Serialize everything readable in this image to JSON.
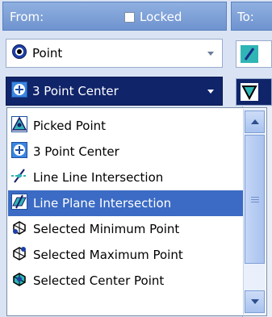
{
  "header": {
    "from_label": "From:",
    "locked_label": "Locked",
    "to_label": "To:"
  },
  "from_combos": [
    {
      "icon": "target-point-icon",
      "label": "Point"
    },
    {
      "icon": "three-point-center-icon",
      "label": "3 Point Center"
    }
  ],
  "dropdown": {
    "items": [
      {
        "icon": "picked-point-icon",
        "label": "Picked Point"
      },
      {
        "icon": "three-point-center-icon",
        "label": "3 Point Center"
      },
      {
        "icon": "line-line-intersection-icon",
        "label": "Line Line Intersection"
      },
      {
        "icon": "line-plane-intersection-icon",
        "label": "Line Plane Intersection"
      },
      {
        "icon": "selected-minimum-point-icon",
        "label": "Selected Minimum Point"
      },
      {
        "icon": "selected-maximum-point-icon",
        "label": "Selected Maximum Point"
      },
      {
        "icon": "selected-center-point-icon",
        "label": "Selected Center Point"
      }
    ],
    "selected_index": 3
  },
  "colors": {
    "header": "#7b9fd8",
    "selection": "#3b6bc4",
    "combo_active": "#10246a"
  }
}
